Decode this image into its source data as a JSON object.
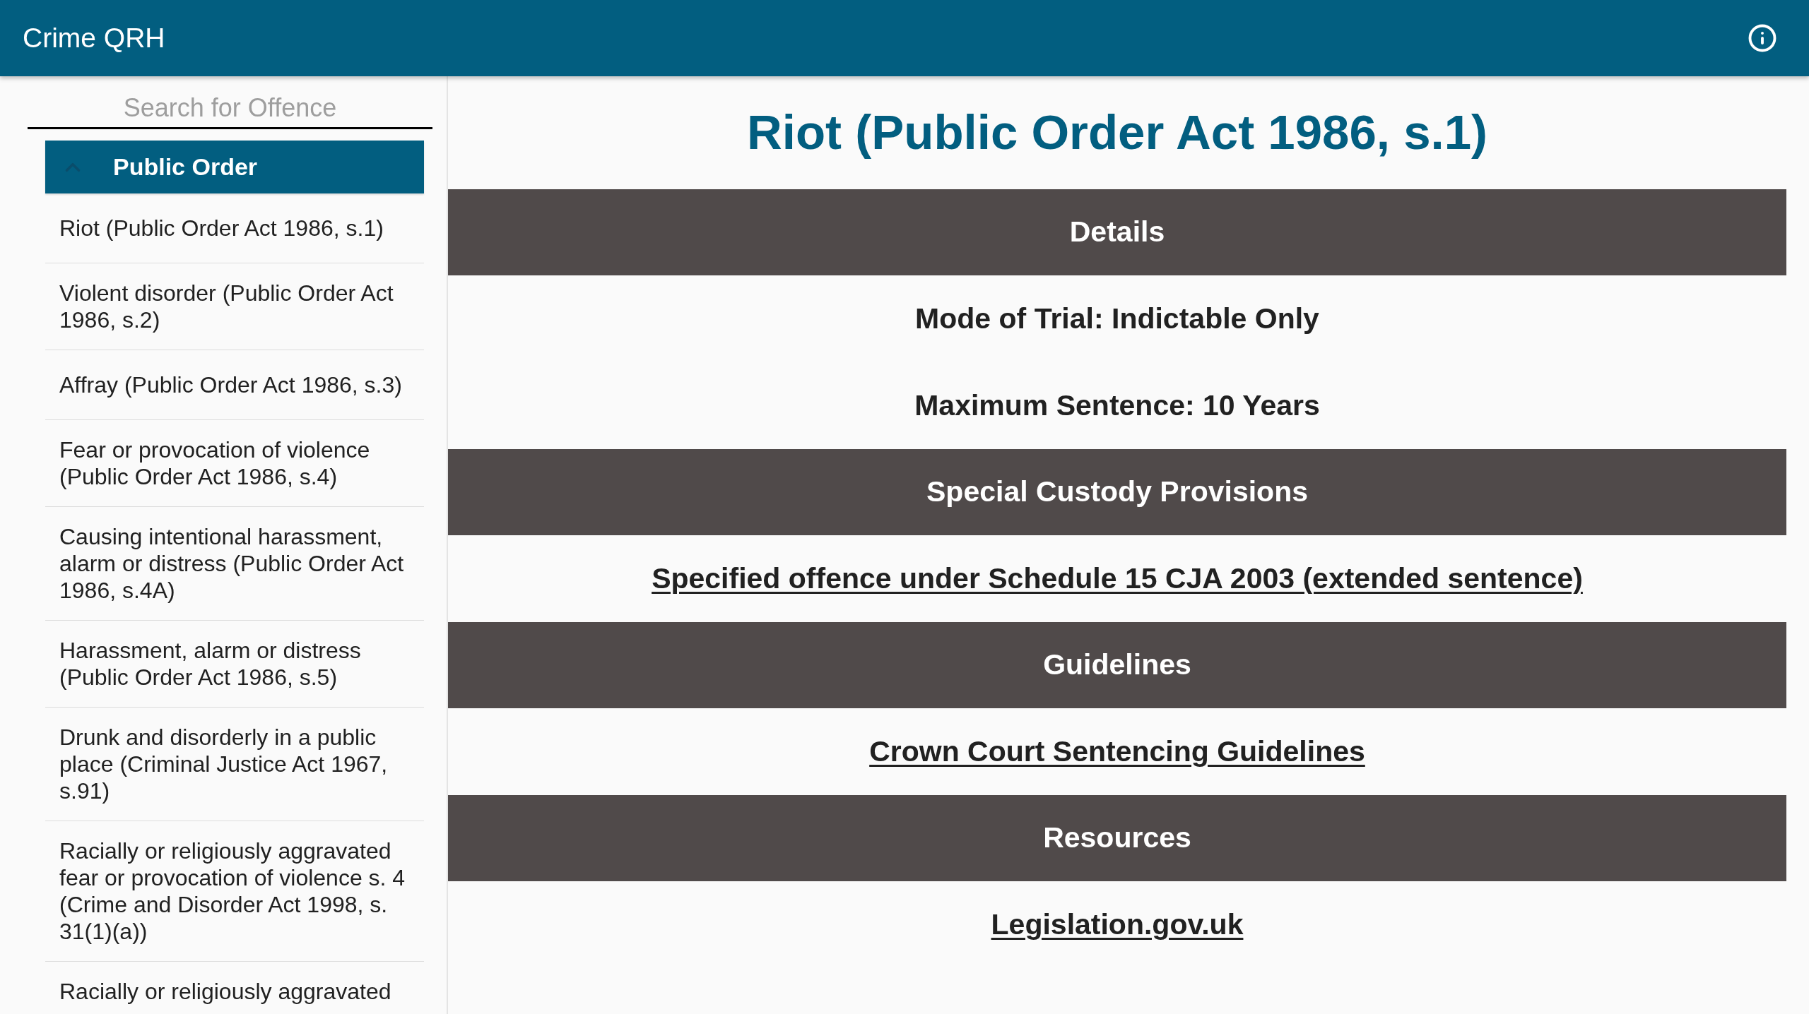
{
  "app_bar": {
    "title": "Crime QRH"
  },
  "sidebar": {
    "search": {
      "placeholder": "Search for Offence"
    },
    "category": {
      "label": "Public Order",
      "expanded": true
    },
    "items": [
      "Riot (Public Order Act 1986, s.1)",
      "Violent disorder (Public Order Act 1986, s.2)",
      "Affray (Public Order Act 1986, s.3)",
      "Fear or provocation of violence (Public Order Act 1986, s.4)",
      "Causing intentional harassment, alarm or distress (Public Order Act 1986, s.4A)",
      "Harassment, alarm or distress (Public Order Act 1986, s.5)",
      "Drunk and disorderly in a public place (Criminal Justice Act 1967, s.91)",
      "Racially or religiously aggravated fear or provocation of violence s. 4 (Crime and Disorder Act 1998, s. 31(1)(a))",
      "Racially or religiously aggravated"
    ]
  },
  "detail": {
    "title": "Riot (Public Order Act 1986, s.1)",
    "sections": [
      {
        "heading": "Details",
        "entries": [
          {
            "kind": "text",
            "text": "Mode of Trial: Indictable Only"
          },
          {
            "kind": "text",
            "text": "Maximum Sentence: 10 Years"
          }
        ]
      },
      {
        "heading": "Special Custody Provisions",
        "entries": [
          {
            "kind": "link",
            "text": "Specified offence under Schedule 15 CJA 2003 (extended sentence)"
          }
        ]
      },
      {
        "heading": "Guidelines",
        "entries": [
          {
            "kind": "link",
            "text": "Crown Court Sentencing Guidelines"
          }
        ]
      },
      {
        "heading": "Resources",
        "entries": [
          {
            "kind": "link",
            "text": "Legislation.gov.uk"
          }
        ]
      }
    ]
  }
}
